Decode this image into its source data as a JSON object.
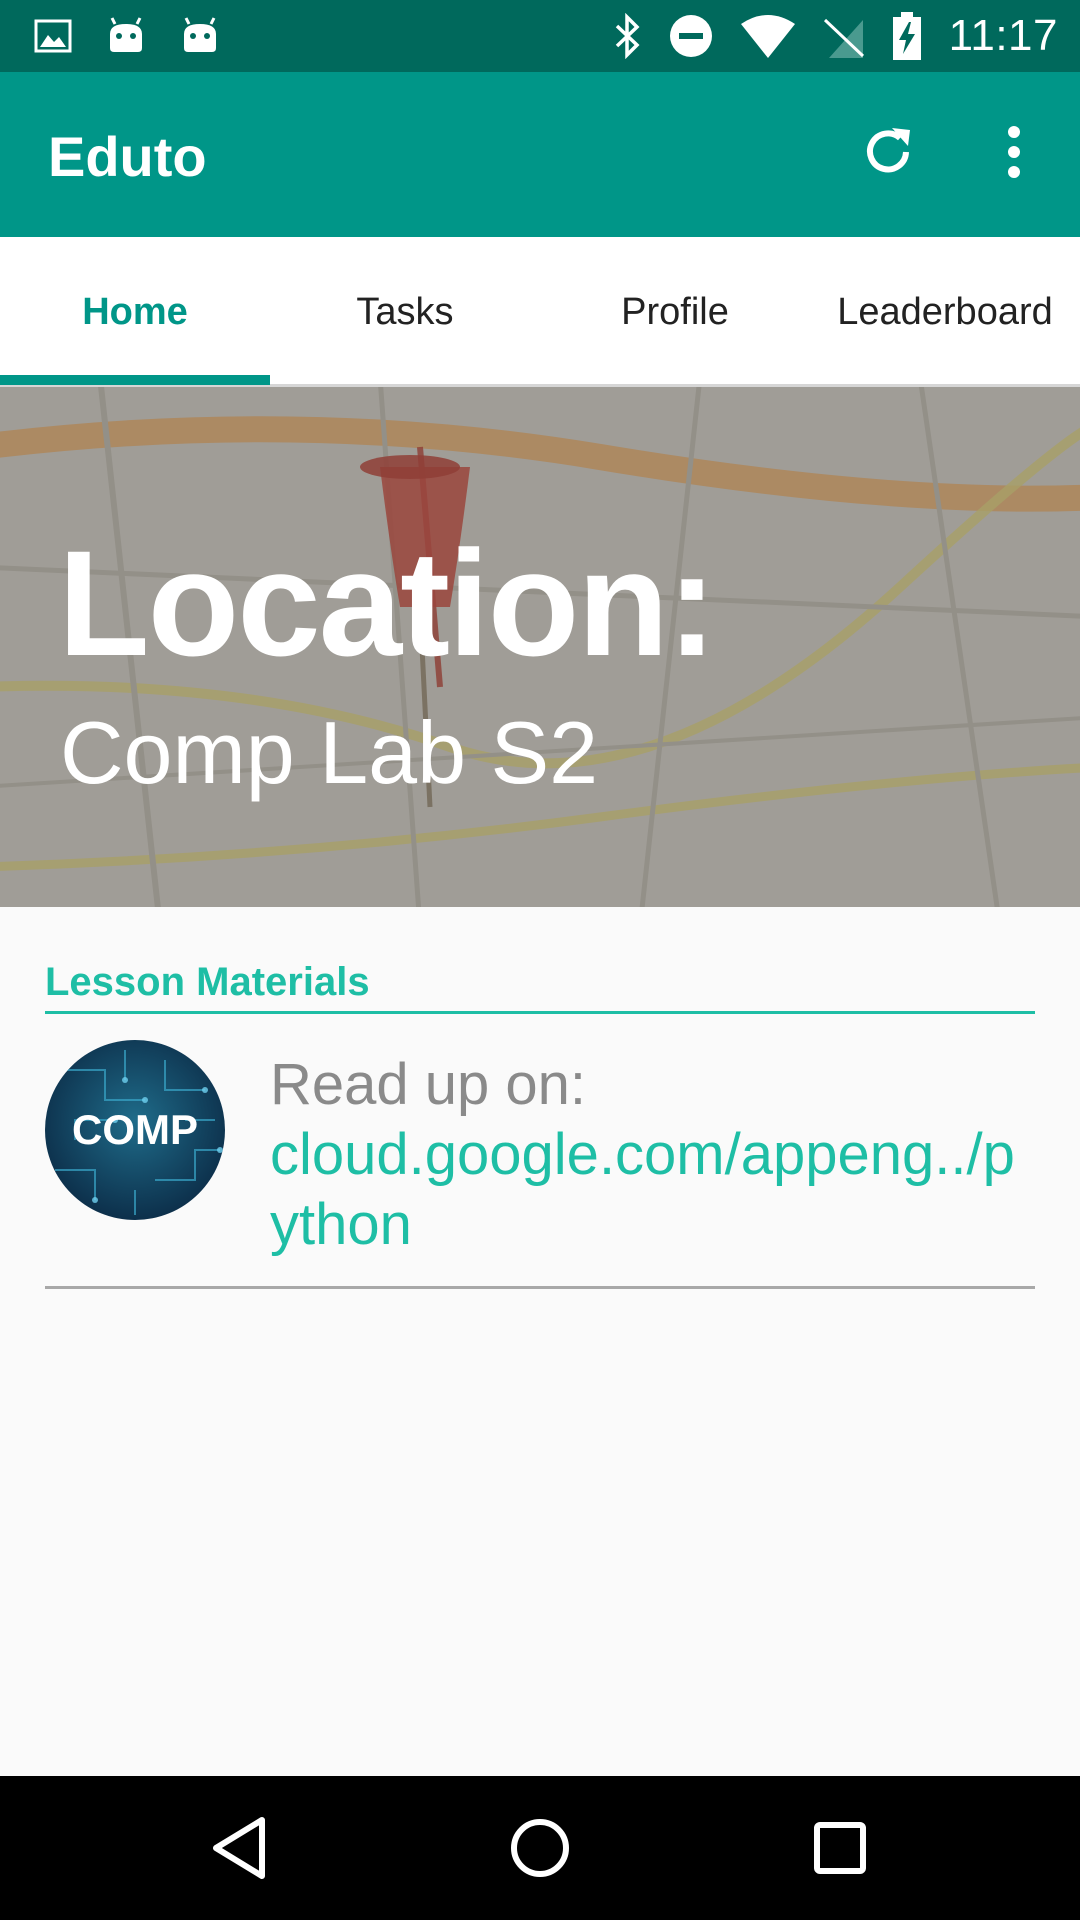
{
  "status_bar": {
    "time": "11:17",
    "left_icons": [
      "image-icon",
      "android-icon",
      "android-icon"
    ],
    "right_icons": [
      "bluetooth-icon",
      "do-not-disturb-icon",
      "wifi-icon",
      "no-sim-icon",
      "battery-charging-icon"
    ]
  },
  "app_bar": {
    "title": "Eduto",
    "actions": [
      "refresh-icon",
      "more-vert-icon"
    ]
  },
  "tabs": [
    {
      "label": "Home",
      "active": true
    },
    {
      "label": "Tasks",
      "active": false
    },
    {
      "label": "Profile",
      "active": false
    },
    {
      "label": "Leaderboard",
      "active": false
    }
  ],
  "banner": {
    "label": "Location:",
    "value": "Comp Lab S2"
  },
  "lesson_materials": {
    "title": "Lesson Materials",
    "items": [
      {
        "avatar_text": "COMP",
        "prefix": "Read up on:",
        "link": "cloud.google.com/appeng../python"
      }
    ]
  },
  "nav_bar": {
    "buttons": [
      "back-icon",
      "home-icon",
      "recents-icon"
    ]
  },
  "colors": {
    "status_bar": "#00695c",
    "primary": "#009688",
    "accent": "#1ebea5"
  }
}
